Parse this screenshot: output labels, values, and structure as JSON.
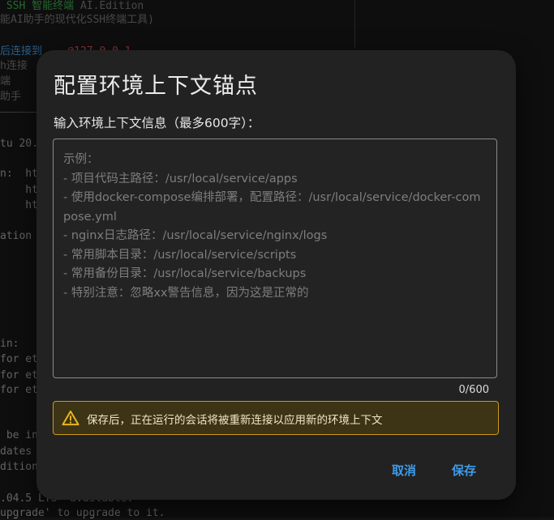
{
  "terminal": {
    "lines": [
      {
        "segments": [
          {
            "text": " SSH 智能终端 ",
            "cls": "t-green"
          },
          {
            "text": "AI.Edition",
            "cls": "t-dim"
          }
        ]
      },
      {
        "segments": [
          {
            "text": "能AI助手的现代化SSH终端工具)",
            "cls": "t-dim"
          }
        ]
      },
      {
        "segments": [
          {
            "text": "后连接到 ",
            "cls": "t-blue"
          },
          {
            "text": "...@127.0.0.1",
            "cls": "t-red"
          }
        ]
      },
      {
        "segments": [
          {
            "text": "h连接",
            "cls": "t-dim"
          }
        ]
      },
      {
        "segments": [
          {
            "text": "端",
            "cls": "t-dim"
          }
        ]
      },
      {
        "segments": [
          {
            "text": "助手",
            "cls": "t-dim"
          }
        ]
      },
      {
        "segments": [
          {
            "text": "tu 20.",
            "cls": ""
          }
        ]
      },
      {
        "segments": [
          {
            "text": "n:  ht",
            "cls": ""
          }
        ]
      },
      {
        "segments": [
          {
            "text": "    ht",
            "cls": ""
          }
        ]
      },
      {
        "segments": [
          {
            "text": "    ht",
            "cls": ""
          }
        ]
      },
      {
        "segments": [
          {
            "text": "ation",
            "cls": ""
          }
        ]
      },
      {
        "segments": [
          {
            "text": "in:",
            "cls": ""
          }
        ]
      },
      {
        "segments": [
          {
            "text": "for et",
            "cls": ""
          }
        ]
      },
      {
        "segments": [
          {
            "text": "for et",
            "cls": ""
          }
        ]
      },
      {
        "segments": [
          {
            "text": "for et",
            "cls": ""
          }
        ]
      },
      {
        "segments": [
          {
            "text": " be in",
            "cls": ""
          }
        ]
      },
      {
        "segments": [
          {
            "text": "dates",
            "cls": ""
          }
        ]
      },
      {
        "segments": [
          {
            "text": "dition",
            "cls": ""
          }
        ]
      },
      {
        "segments": [
          {
            "text": ".04.5 LTS' available.",
            "cls": ""
          }
        ]
      },
      {
        "segments": [
          {
            "text": "upgrade' to upgrade to it.",
            "cls": ""
          }
        ]
      }
    ]
  },
  "dialog": {
    "title": "配置环境上下文锚点",
    "field_label": "输入环境上下文信息（最多600字）：",
    "textarea_placeholder": "示例：\n- 项目代码主路径：/usr/local/service/apps\n- 使用docker-compose编排部署，配置路径：/usr/local/service/docker-compose.yml\n- nginx日志路径：/usr/local/service/nginx/logs\n- 常用脚本目录：/usr/local/service/scripts\n- 常用备份目录：/usr/local/service/backups\n- 特别注意：忽略xx警告信息，因为这是正常的",
    "textarea_value": "",
    "counter": "0/600",
    "warning_text": "保存后，正在运行的会话将被重新连接以应用新的环境上下文",
    "warning_icon": "warning-triangle-icon",
    "cancel_label": "取消",
    "save_label": "保存",
    "colors": {
      "accent": "#3f9be8",
      "warning_border": "#c79a22",
      "warning_bg": "#3d3415",
      "dialog_bg": "#222222"
    }
  }
}
